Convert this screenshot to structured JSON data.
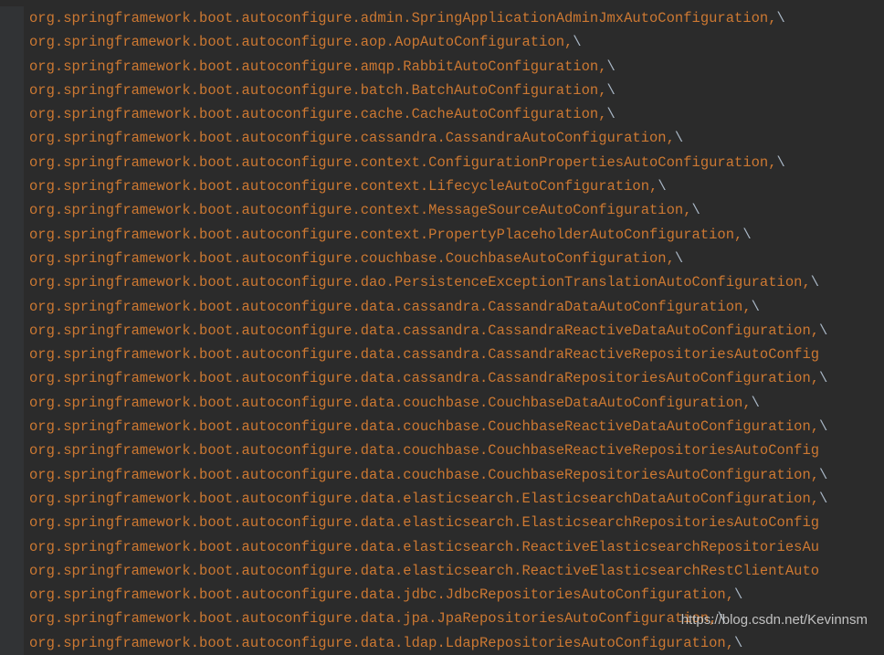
{
  "editor": {
    "lines": [
      {
        "text": "org.springframework.boot.autoconfigure.admin.SpringApplicationAdminJmxAutoConfiguration,",
        "suffix": "\\"
      },
      {
        "text": "org.springframework.boot.autoconfigure.aop.AopAutoConfiguration,",
        "suffix": "\\"
      },
      {
        "text": "org.springframework.boot.autoconfigure.amqp.RabbitAutoConfiguration,",
        "suffix": "\\"
      },
      {
        "text": "org.springframework.boot.autoconfigure.batch.BatchAutoConfiguration,",
        "suffix": "\\"
      },
      {
        "text": "org.springframework.boot.autoconfigure.cache.CacheAutoConfiguration,",
        "suffix": "\\"
      },
      {
        "text": "org.springframework.boot.autoconfigure.cassandra.CassandraAutoConfiguration,",
        "suffix": "\\"
      },
      {
        "text": "org.springframework.boot.autoconfigure.context.ConfigurationPropertiesAutoConfiguration,",
        "suffix": "\\"
      },
      {
        "text": "org.springframework.boot.autoconfigure.context.LifecycleAutoConfiguration,",
        "suffix": "\\"
      },
      {
        "text": "org.springframework.boot.autoconfigure.context.MessageSourceAutoConfiguration,",
        "suffix": "\\"
      },
      {
        "text": "org.springframework.boot.autoconfigure.context.PropertyPlaceholderAutoConfiguration,",
        "suffix": "\\"
      },
      {
        "text": "org.springframework.boot.autoconfigure.couchbase.CouchbaseAutoConfiguration,",
        "suffix": "\\"
      },
      {
        "text": "org.springframework.boot.autoconfigure.dao.PersistenceExceptionTranslationAutoConfiguration,",
        "suffix": "\\"
      },
      {
        "text": "org.springframework.boot.autoconfigure.data.cassandra.CassandraDataAutoConfiguration,",
        "suffix": "\\"
      },
      {
        "text": "org.springframework.boot.autoconfigure.data.cassandra.CassandraReactiveDataAutoConfiguration,",
        "suffix": "\\"
      },
      {
        "text": "org.springframework.boot.autoconfigure.data.cassandra.CassandraReactiveRepositoriesAutoConfig",
        "suffix": ""
      },
      {
        "text": "org.springframework.boot.autoconfigure.data.cassandra.CassandraRepositoriesAutoConfiguration,",
        "suffix": "\\"
      },
      {
        "text": "org.springframework.boot.autoconfigure.data.couchbase.CouchbaseDataAutoConfiguration,",
        "suffix": "\\"
      },
      {
        "text": "org.springframework.boot.autoconfigure.data.couchbase.CouchbaseReactiveDataAutoConfiguration,",
        "suffix": "\\"
      },
      {
        "text": "org.springframework.boot.autoconfigure.data.couchbase.CouchbaseReactiveRepositoriesAutoConfig",
        "suffix": ""
      },
      {
        "text": "org.springframework.boot.autoconfigure.data.couchbase.CouchbaseRepositoriesAutoConfiguration,",
        "suffix": "\\"
      },
      {
        "text": "org.springframework.boot.autoconfigure.data.elasticsearch.ElasticsearchDataAutoConfiguration,",
        "suffix": "\\"
      },
      {
        "text": "org.springframework.boot.autoconfigure.data.elasticsearch.ElasticsearchRepositoriesAutoConfig",
        "suffix": ""
      },
      {
        "text": "org.springframework.boot.autoconfigure.data.elasticsearch.ReactiveElasticsearchRepositoriesAu",
        "suffix": ""
      },
      {
        "text": "org.springframework.boot.autoconfigure.data.elasticsearch.ReactiveElasticsearchRestClientAuto",
        "suffix": ""
      },
      {
        "text": "org.springframework.boot.autoconfigure.data.jdbc.JdbcRepositoriesAutoConfiguration,",
        "suffix": "\\"
      },
      {
        "text": "org.springframework.boot.autoconfigure.data.jpa.JpaRepositoriesAutoConfiguration,",
        "suffix": "\\"
      },
      {
        "text": "org.springframework.boot.autoconfigure.data.ldap.LdapRepositoriesAutoConfiguration,",
        "suffix": "\\"
      }
    ]
  },
  "watermark": "https://blog.csdn.net/Kevinnsm"
}
